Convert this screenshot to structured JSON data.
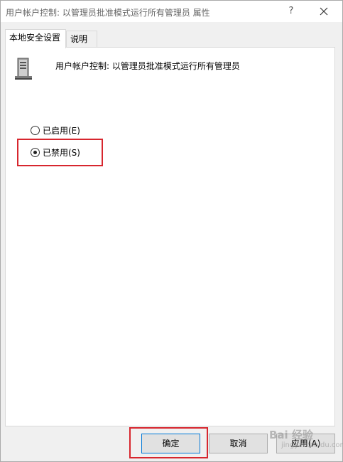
{
  "window": {
    "title": "用户帐户控制: 以管理员批准模式运行所有管理员 属性",
    "help_label": "?"
  },
  "tabs": [
    {
      "label": "本地安全设置",
      "active": true
    },
    {
      "label": "说明",
      "active": false
    }
  ],
  "policy": {
    "name": "用户帐户控制: 以管理员批准模式运行所有管理员",
    "icon": "server-icon"
  },
  "options": [
    {
      "label": "已启用(E)",
      "checked": false
    },
    {
      "label": "已禁用(S)",
      "checked": true
    }
  ],
  "buttons": {
    "ok": "确定",
    "cancel": "取消",
    "apply": "应用(A)"
  },
  "watermark": {
    "text": "Bai 经验",
    "sub": "jingyan.baidu.com"
  },
  "colors": {
    "highlight": "#d7262e",
    "accent": "#0078d7"
  }
}
